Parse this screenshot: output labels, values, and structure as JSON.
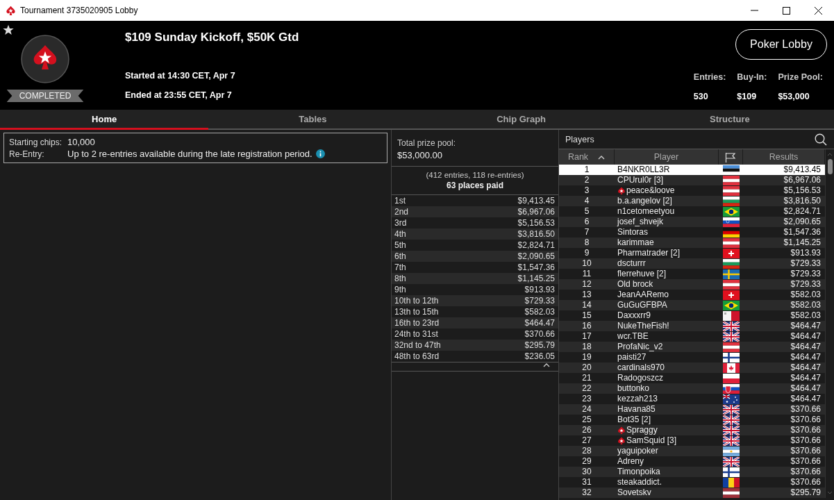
{
  "window": {
    "title": "Tournament 3735020905 Lobby"
  },
  "header": {
    "status": "COMPLETED",
    "title": "$109 Sunday Kickoff, $50K Gtd",
    "started": "Started at 14:30 CET, Apr 7",
    "ended": "Ended at 23:55 CET, Apr 7",
    "button": "Poker Lobby",
    "stats": [
      {
        "label": "Entries:",
        "value": "530"
      },
      {
        "label": "Buy-In:",
        "value": "$109"
      },
      {
        "label": "Prize Pool:",
        "value": "$53,000"
      }
    ]
  },
  "tabs": [
    {
      "label": "Home",
      "selected": true
    },
    {
      "label": "Tables",
      "selected": false
    },
    {
      "label": "Chip Graph",
      "selected": false
    },
    {
      "label": "Structure",
      "selected": false
    }
  ],
  "info": [
    {
      "label": "Starting chips:",
      "value": "10,000",
      "info": false
    },
    {
      "label": "Re-Entry:",
      "value": "Up to 2 re-entries available during the late registration period.",
      "info": true
    }
  ],
  "prize": {
    "label": "Total prize pool:",
    "amount": "$53,000.00",
    "note": "(412 entries, 118 re-entries)",
    "places_paid": "63 places paid",
    "payouts": [
      {
        "place": "1st",
        "amount": "$9,413.45"
      },
      {
        "place": "2nd",
        "amount": "$6,967.06"
      },
      {
        "place": "3rd",
        "amount": "$5,156.53"
      },
      {
        "place": "4th",
        "amount": "$3,816.50"
      },
      {
        "place": "5th",
        "amount": "$2,824.71"
      },
      {
        "place": "6th",
        "amount": "$2,090.65"
      },
      {
        "place": "7th",
        "amount": "$1,547.36"
      },
      {
        "place": "8th",
        "amount": "$1,145.25"
      },
      {
        "place": "9th",
        "amount": "$913.93"
      },
      {
        "place": "10th to 12th",
        "amount": "$729.33"
      },
      {
        "place": "13th to 15th",
        "amount": "$582.03"
      },
      {
        "place": "16th to 23rd",
        "amount": "$464.47"
      },
      {
        "place": "24th to 31st",
        "amount": "$370.66"
      },
      {
        "place": "32nd to 47th",
        "amount": "$295.79"
      },
      {
        "place": "48th to 63rd",
        "amount": "$236.05"
      }
    ]
  },
  "players": {
    "title": "Players",
    "columns": [
      "Rank",
      "Player",
      "Results"
    ],
    "rows": [
      {
        "rank": "1",
        "name": "B4NKR0LL3R",
        "pro": false,
        "kind": "estonia",
        "result": "$9,413.45",
        "selected": true
      },
      {
        "rank": "2",
        "name": "CPUrul0r [3]",
        "pro": false,
        "kind": "austria",
        "result": "$6,967.06",
        "selected": false
      },
      {
        "rank": "3",
        "name": "peace&loove",
        "pro": true,
        "kind": "austria",
        "result": "$5,156.53",
        "selected": false
      },
      {
        "rank": "4",
        "name": "b.a.angelov [2]",
        "pro": false,
        "kind": "bulgaria",
        "result": "$3,816.50",
        "selected": false
      },
      {
        "rank": "5",
        "name": "n1cetomeetyou",
        "pro": false,
        "kind": "brazil",
        "result": "$2,824.71",
        "selected": false
      },
      {
        "rank": "6",
        "name": "josef_shvejk",
        "pro": false,
        "kind": "slovenia",
        "result": "$2,090.65",
        "selected": false
      },
      {
        "rank": "7",
        "name": "Sintoras",
        "pro": false,
        "kind": "germany",
        "result": "$1,547.36",
        "selected": false
      },
      {
        "rank": "8",
        "name": "karimmae",
        "pro": false,
        "kind": "austria",
        "result": "$1,145.25",
        "selected": false
      },
      {
        "rank": "9",
        "name": "Pharmatrader [2]",
        "pro": false,
        "kind": "switzerland",
        "result": "$913.93",
        "selected": false
      },
      {
        "rank": "10",
        "name": "dscturrr",
        "pro": false,
        "kind": "bulgaria",
        "result": "$729.33",
        "selected": false
      },
      {
        "rank": "11",
        "name": "flerrehuve [2]",
        "pro": false,
        "kind": "sweden",
        "result": "$729.33",
        "selected": false
      },
      {
        "rank": "12",
        "name": "Old brock",
        "pro": false,
        "kind": "austria",
        "result": "$729.33",
        "selected": false
      },
      {
        "rank": "13",
        "name": "JeanAARemo",
        "pro": false,
        "kind": "switzerland",
        "result": "$582.03",
        "selected": false
      },
      {
        "rank": "14",
        "name": "GuGuGFBPA",
        "pro": false,
        "kind": "brazil",
        "result": "$582.03",
        "selected": false
      },
      {
        "rank": "15",
        "name": "Daxxxrr9",
        "pro": false,
        "kind": "malta",
        "result": "$582.03",
        "selected": false
      },
      {
        "rank": "16",
        "name": "NukeTheFish!",
        "pro": false,
        "kind": "uk",
        "result": "$464.47",
        "selected": false
      },
      {
        "rank": "17",
        "name": "wcr.TBE",
        "pro": false,
        "kind": "uk",
        "result": "$464.47",
        "selected": false
      },
      {
        "rank": "18",
        "name": "ProfaNic_v2",
        "pro": false,
        "kind": "austria",
        "result": "$464.47",
        "selected": false
      },
      {
        "rank": "19",
        "name": "paisti27",
        "pro": false,
        "kind": "finland",
        "result": "$464.47",
        "selected": false
      },
      {
        "rank": "20",
        "name": "cardinals970",
        "pro": false,
        "kind": "canada",
        "result": "$464.47",
        "selected": false
      },
      {
        "rank": "21",
        "name": "Radogoszcz",
        "pro": false,
        "kind": "poland",
        "result": "$464.47",
        "selected": false
      },
      {
        "rank": "22",
        "name": "buttonko",
        "pro": false,
        "kind": "slovakia",
        "result": "$464.47",
        "selected": false
      },
      {
        "rank": "23",
        "name": "kezzah213",
        "pro": false,
        "kind": "australia",
        "result": "$464.47",
        "selected": false
      },
      {
        "rank": "24",
        "name": "Havana85",
        "pro": false,
        "kind": "uk",
        "result": "$370.66",
        "selected": false
      },
      {
        "rank": "25",
        "name": "Bot35 [2]",
        "pro": false,
        "kind": "uk",
        "result": "$370.66",
        "selected": false
      },
      {
        "rank": "26",
        "name": "Spraggy",
        "pro": true,
        "kind": "uk",
        "result": "$370.66",
        "selected": false
      },
      {
        "rank": "27",
        "name": "SamSquid [3]",
        "pro": true,
        "kind": "uk",
        "result": "$370.66",
        "selected": false
      },
      {
        "rank": "28",
        "name": "yaguipoker",
        "pro": false,
        "kind": "argentina",
        "result": "$370.66",
        "selected": false
      },
      {
        "rank": "29",
        "name": "Adreny",
        "pro": false,
        "kind": "uk",
        "result": "$370.66",
        "selected": false
      },
      {
        "rank": "30",
        "name": "Timonpoika",
        "pro": false,
        "kind": "finland",
        "result": "$370.66",
        "selected": false
      },
      {
        "rank": "31",
        "name": "steakaddict.",
        "pro": false,
        "kind": "romania",
        "result": "$370.66",
        "selected": false
      },
      {
        "rank": "32",
        "name": "Sovetskv",
        "pro": false,
        "kind": "latvia",
        "result": "$295.79",
        "selected": false
      }
    ]
  }
}
